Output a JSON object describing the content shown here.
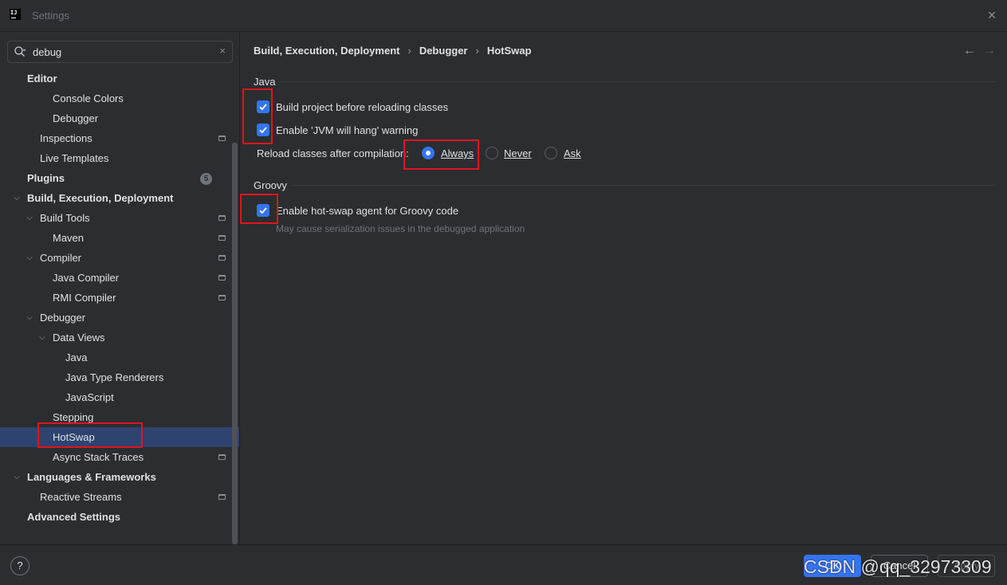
{
  "window": {
    "title": "Settings"
  },
  "search": {
    "value": "debug"
  },
  "tree": [
    {
      "label": "Editor",
      "bold": true
    },
    {
      "label": "Console Colors"
    },
    {
      "label": "Debugger"
    },
    {
      "label": "Inspections"
    },
    {
      "label": "Live Templates"
    },
    {
      "label": "Plugins",
      "bold": true,
      "badge": "5"
    },
    {
      "label": "Build, Execution, Deployment",
      "bold": true
    },
    {
      "label": "Build Tools"
    },
    {
      "label": "Maven"
    },
    {
      "label": "Compiler"
    },
    {
      "label": "Java Compiler"
    },
    {
      "label": "RMI Compiler"
    },
    {
      "label": "Debugger"
    },
    {
      "label": "Data Views"
    },
    {
      "label": "Java"
    },
    {
      "label": "Java Type Renderers"
    },
    {
      "label": "JavaScript"
    },
    {
      "label": "Stepping"
    },
    {
      "label": "HotSwap",
      "selected": true
    },
    {
      "label": "Async Stack Traces"
    },
    {
      "label": "Languages & Frameworks",
      "bold": true
    },
    {
      "label": "Reactive Streams"
    },
    {
      "label": "Advanced Settings",
      "bold": true
    }
  ],
  "breadcrumb": [
    "Build, Execution, Deployment",
    "Debugger",
    "HotSwap"
  ],
  "java": {
    "title": "Java",
    "build_before_reload": {
      "label": "Build project before reloading classes",
      "checked": true
    },
    "jvm_hang_warning": {
      "label": "Enable 'JVM will hang' warning",
      "checked": true
    },
    "reload_label": "Reload classes after compilation:",
    "reload_options": [
      {
        "label": "Always",
        "selected": true
      },
      {
        "label": "Never",
        "selected": false
      },
      {
        "label": "Ask",
        "selected": false
      }
    ]
  },
  "groovy": {
    "title": "Groovy",
    "hotswap_agent": {
      "label": "Enable hot-swap agent for Groovy code",
      "checked": true
    },
    "hint": "May cause serialization issues in the debugged application"
  },
  "footer": {
    "help": "?",
    "ok": "OK",
    "cancel": "Cancel",
    "apply": "Apply",
    "watermark": "CSDN @qq_32973309"
  },
  "colors": {
    "accent": "#3574f0",
    "selection": "#2e436e",
    "annotation": "#e0141e"
  }
}
